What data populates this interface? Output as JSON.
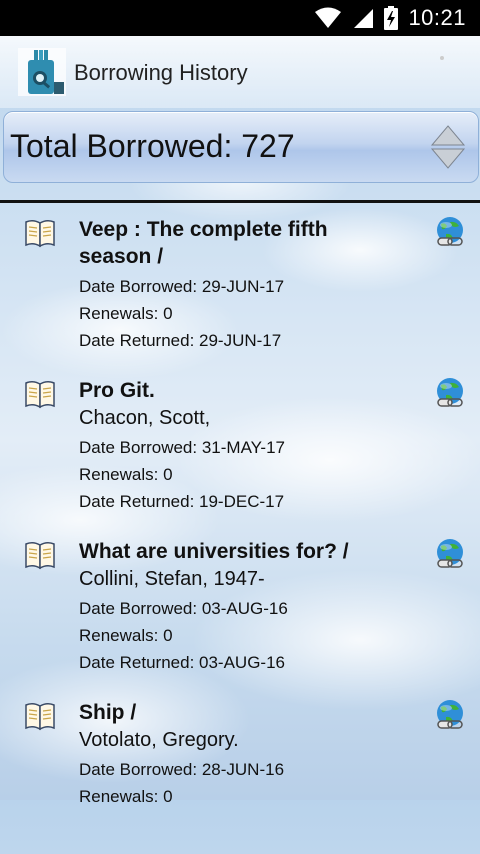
{
  "status_bar": {
    "time": "10:21"
  },
  "app": {
    "title": "Borrowing History"
  },
  "summary": {
    "total_label": "Total Borrowed: 727"
  },
  "items": [
    {
      "title": "Veep : The complete fifth season /",
      "author": "",
      "date_borrowed": "Date Borrowed: 29-JUN-17",
      "renewals": "Renewals: 0",
      "date_returned": "Date Returned: 29-JUN-17"
    },
    {
      "title": "Pro Git.",
      "author": "Chacon, Scott,",
      "date_borrowed": "Date Borrowed: 31-MAY-17",
      "renewals": "Renewals: 0",
      "date_returned": "Date Returned: 19-DEC-17"
    },
    {
      "title": "What are universities for? /",
      "author": "Collini, Stefan, 1947-",
      "date_borrowed": "Date Borrowed: 03-AUG-16",
      "renewals": "Renewals: 0",
      "date_returned": "Date Returned: 03-AUG-16"
    },
    {
      "title": "Ship /",
      "author": "Votolato, Gregory.",
      "date_borrowed": "Date Borrowed: 28-JUN-16",
      "renewals": "Renewals: 0",
      "date_returned": ""
    }
  ],
  "icons": {
    "item_type": "book-icon",
    "item_link": "globe-link-icon"
  }
}
